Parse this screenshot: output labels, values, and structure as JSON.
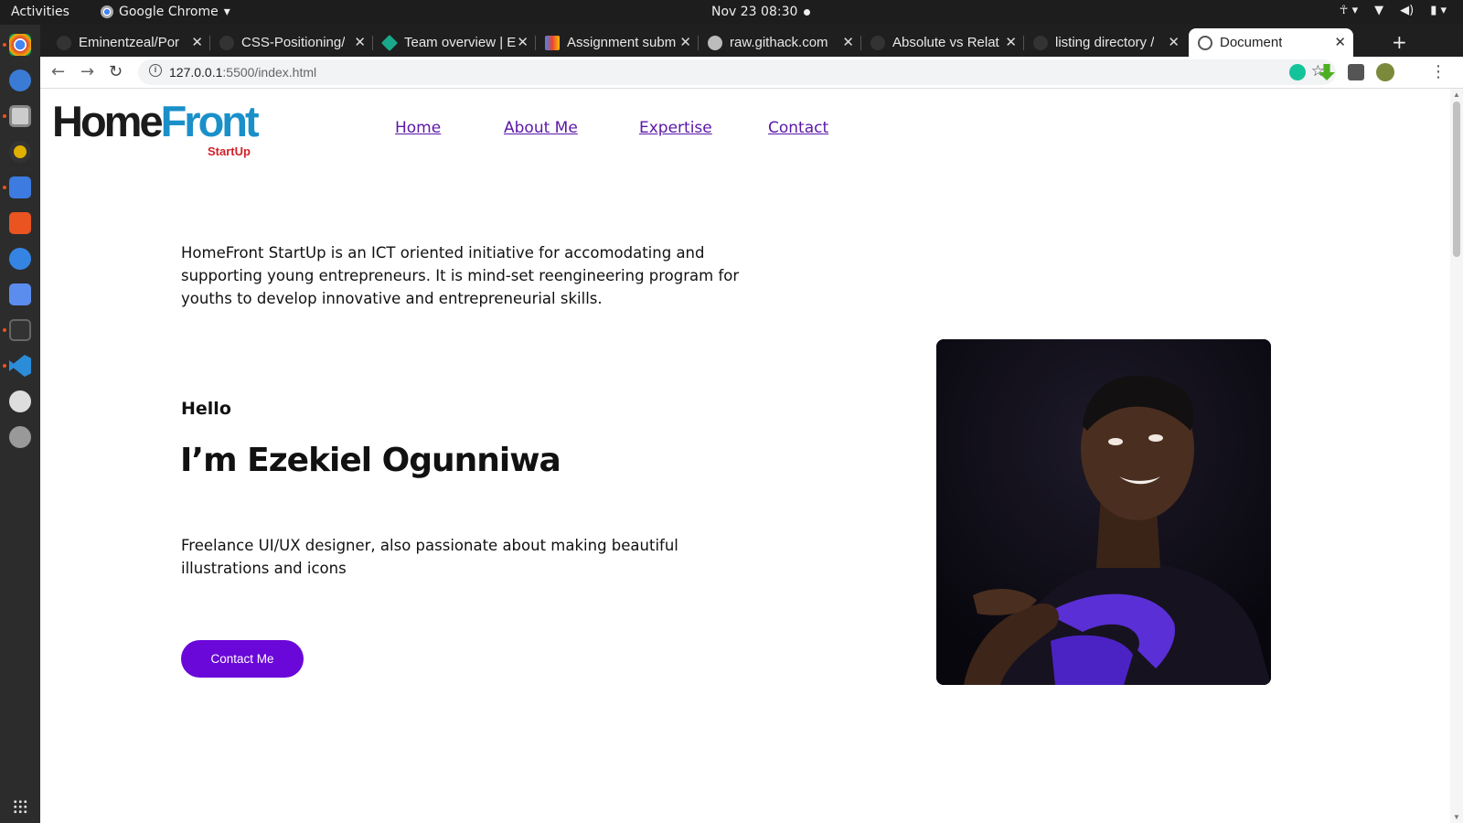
{
  "os": {
    "activities": "Activities",
    "app_name": "Google Chrome",
    "clock": "Nov 23  08:30"
  },
  "browser": {
    "tabs": [
      {
        "title": "Eminentzeal/Por"
      },
      {
        "title": "CSS-Positioning/"
      },
      {
        "title": "Team overview | E"
      },
      {
        "title": "Assignment subm"
      },
      {
        "title": "raw.githack.com"
      },
      {
        "title": "Absolute vs Relat"
      },
      {
        "title": "listing directory /"
      },
      {
        "title": "Document"
      }
    ],
    "url_host": "127.0.0.1",
    "url_path": ":5500/index.html"
  },
  "page": {
    "logo": {
      "home": "Home",
      "front": "Front",
      "startup": "StartUp"
    },
    "nav": [
      "Home",
      "About Me",
      "Expertise",
      "Contact"
    ],
    "intro": "HomeFront StartUp is an ICT oriented initiative for accomodating and supporting young entrepreneurs. It is mind-set reengineering program for youths to develop innovative and entrepreneurial skills.",
    "hello": "Hello",
    "name": "I’m Ezekiel Ogunniwa",
    "description": "Freelance UI/UX designer, also passionate about making beautiful illustrations and icons",
    "contact_button": "Contact Me"
  },
  "colors": {
    "accent_purple": "#6a07d9",
    "nav_link": "#5b17a8",
    "logo_blue": "#1a90c9",
    "logo_red": "#d4202a"
  }
}
